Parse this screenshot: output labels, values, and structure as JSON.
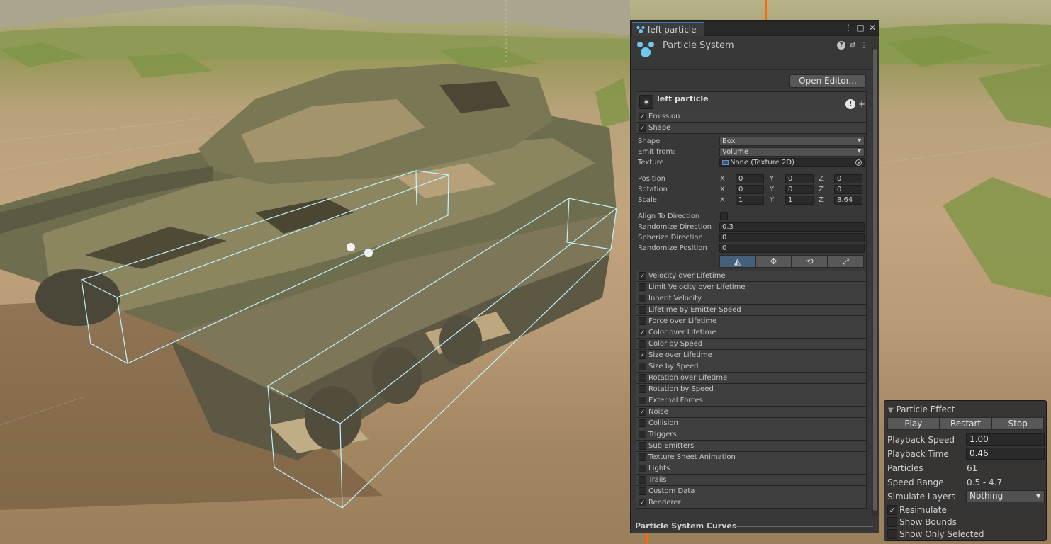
{
  "inspector": {
    "tab_title": "left particle",
    "component_title": "Particle System",
    "open_editor_label": "Open Editor...",
    "system_name": "left particle",
    "warn_glyph": "!",
    "add_glyph": "+",
    "modules_top": [
      {
        "label": "Emission",
        "enabled": true
      },
      {
        "label": "Shape",
        "enabled": true
      }
    ],
    "shape": {
      "shape_label": "Shape",
      "shape_value": "Box",
      "emit_label": "Emit from:",
      "emit_value": "Volume",
      "texture_label": "Texture",
      "texture_value": "None (Texture 2D)",
      "position_label": "Position",
      "position": {
        "x": "0",
        "y": "0",
        "z": "0"
      },
      "rotation_label": "Rotation",
      "rotation": {
        "x": "0",
        "y": "0",
        "z": "0"
      },
      "scale_label": "Scale",
      "scale": {
        "x": "1",
        "y": "1",
        "z": "8.64"
      },
      "axis_x": "X",
      "axis_y": "Y",
      "axis_z": "Z",
      "align_label": "Align To Direction",
      "randomize_dir_label": "Randomize Direction",
      "randomize_dir_value": "0.3",
      "spherize_label": "Spherize Direction",
      "spherize_value": "0",
      "randomize_pos_label": "Randomize Position",
      "randomize_pos_value": "0"
    },
    "modules": [
      {
        "label": "Velocity over Lifetime",
        "enabled": true
      },
      {
        "label": "Limit Velocity over Lifetime",
        "enabled": false
      },
      {
        "label": "Inherit Velocity",
        "enabled": false
      },
      {
        "label": "Lifetime by Emitter Speed",
        "enabled": false
      },
      {
        "label": "Force over Lifetime",
        "enabled": false
      },
      {
        "label": "Color over Lifetime",
        "enabled": true
      },
      {
        "label": "Color by Speed",
        "enabled": false
      },
      {
        "label": "Size over Lifetime",
        "enabled": true
      },
      {
        "label": "Size by Speed",
        "enabled": false
      },
      {
        "label": "Rotation over Lifetime",
        "enabled": false
      },
      {
        "label": "Rotation by Speed",
        "enabled": false
      },
      {
        "label": "External Forces",
        "enabled": false
      },
      {
        "label": "Noise",
        "enabled": true
      },
      {
        "label": "Collision",
        "enabled": false
      },
      {
        "label": "Triggers",
        "enabled": false
      },
      {
        "label": "Sub Emitters",
        "enabled": false
      },
      {
        "label": "Texture Sheet Animation",
        "enabled": false
      },
      {
        "label": "Lights",
        "enabled": false
      },
      {
        "label": "Trails",
        "enabled": false
      },
      {
        "label": "Custom Data",
        "enabled": false
      },
      {
        "label": "Renderer",
        "enabled": true
      }
    ],
    "curves_label": "Particle System Curves",
    "check_glyph": "✓",
    "window_icons": {
      "menu": "⋮",
      "maximize": "□",
      "close": "✕"
    }
  },
  "particle_effect": {
    "title": "Particle Effect",
    "buttons": [
      "Play",
      "Restart",
      "Stop"
    ],
    "playback_speed_label": "Playback Speed",
    "playback_speed": "1.00",
    "playback_time_label": "Playback Time",
    "playback_time": "0.46",
    "particles_label": "Particles",
    "particles": "61",
    "speed_range_label": "Speed Range",
    "speed_range": "0.5 - 4.7",
    "simulate_layers_label": "Simulate Layers",
    "simulate_layers": "Nothing",
    "resimulate_label": "Resimulate",
    "resimulate": true,
    "show_bounds_label": "Show Bounds",
    "show_bounds": false,
    "show_only_selected_label": "Show Only Selected",
    "show_only_selected": false
  },
  "colors": {
    "accent": "#3a79bb",
    "bounds_gizmo": "#bff3ff",
    "axis_orange": "#ff6a00"
  }
}
